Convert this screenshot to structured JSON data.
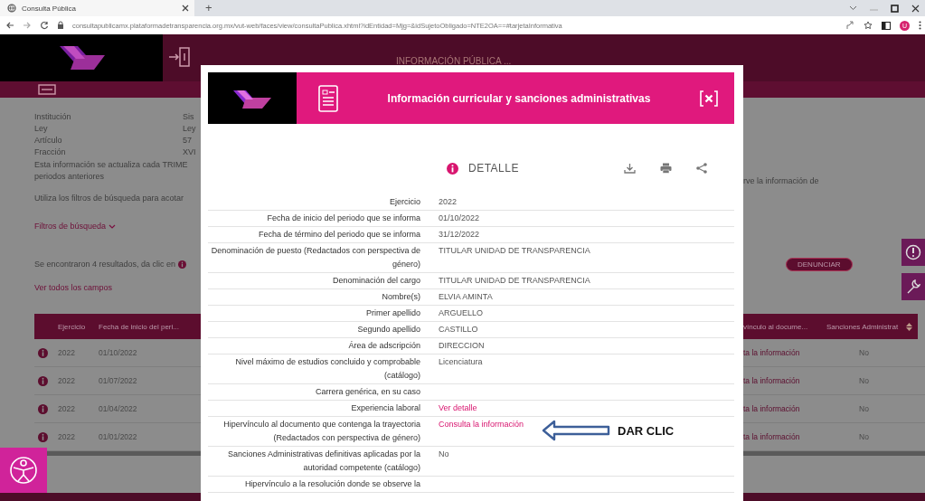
{
  "browser": {
    "tab_title": "Consulta Pública",
    "new_tab": "+",
    "url": "consultapublicamx.plataformadetransparencia.org.mx/vut-web/faces/view/consultaPublica.xhtml?idEntidad=Mjg=&idSujetoObligado=NTE2OA==#tarjetaInformativa",
    "profile_initial": "U"
  },
  "page": {
    "header_title": "INFORMACIÓN PÚBLICA ...",
    "facts": [
      {
        "label": "Institución",
        "value": "Sis"
      },
      {
        "label": "Ley",
        "value": "Ley"
      },
      {
        "label": "Artículo",
        "value": "57"
      },
      {
        "label": "Fracción",
        "value": "XVI"
      }
    ],
    "notice_lines": [
      "Esta información se actualiza cada TRIME",
      "periodos anteriores"
    ],
    "filter_hint": "Utiliza los filtros de búsqueda para acotar",
    "filters_link": "Filtros de búsqueda",
    "results_text": "Se encontraron 4 resultados, da clic en",
    "all_fields_link": "Ver todos los campos",
    "right_notice": "rve la información de",
    "report_button": "DENUNCIAR",
    "table": {
      "columns_left": [
        "Ejercicio",
        "Fecha de inicio del peri..."
      ],
      "columns_right": [
        "vínculo al docume...",
        "Sanciones Administrat"
      ],
      "rows": [
        {
          "ejercicio": "2022",
          "fecha_inicio": "01/10/2022",
          "hipervinculo": "ta la información",
          "sanciones": "No"
        },
        {
          "ejercicio": "2022",
          "fecha_inicio": "01/07/2022",
          "hipervinculo": "ta la información",
          "sanciones": "No"
        },
        {
          "ejercicio": "2022",
          "fecha_inicio": "01/04/2022",
          "hipervinculo": "ta la información",
          "sanciones": "No"
        },
        {
          "ejercicio": "2022",
          "fecha_inicio": "01/01/2022",
          "hipervinculo": "ta la información",
          "sanciones": "No"
        }
      ]
    }
  },
  "modal": {
    "title": "Información curricular y sanciones administrativas",
    "section": "DETALLE",
    "fields": [
      {
        "label": "Ejercicio",
        "value": "2022",
        "kind": "text"
      },
      {
        "label": "Fecha de inicio del periodo que se informa",
        "value": "01/10/2022",
        "kind": "text"
      },
      {
        "label": "Fecha de término del periodo que se informa",
        "value": "31/12/2022",
        "kind": "text"
      },
      {
        "label": "Denominación de puesto (Redactados con perspectiva de género)",
        "value": "TITULAR UNIDAD DE TRANSPARENCIA",
        "kind": "text"
      },
      {
        "label": "Denominación del cargo",
        "value": "TITULAR UNIDAD DE TRANSPARENCIA",
        "kind": "text"
      },
      {
        "label": "Nombre(s)",
        "value": "ELVIA AMINTA",
        "kind": "text"
      },
      {
        "label": "Primer apellido",
        "value": "ARGUELLO",
        "kind": "text"
      },
      {
        "label": "Segundo apellido",
        "value": "CASTILLO",
        "kind": "text"
      },
      {
        "label": "Área de adscripción",
        "value": "DIRECCION",
        "kind": "text"
      },
      {
        "label": "Nivel máximo de estudios concluido y comprobable (catálogo)",
        "value": "Licenciatura",
        "kind": "text"
      },
      {
        "label": "Carrera genérica, en su caso"
      },
      {
        "label": "Experiencia laboral",
        "value": "Ver detalle",
        "kind": "link"
      },
      {
        "label": "Hipervínculo al documento que contenga la trayectoria (Redactados con perspectiva de género)",
        "value": "Consulta la información",
        "kind": "link",
        "annotation": "DAR CLIC"
      },
      {
        "label": "Sanciones Administrativas definitivas aplicadas por la autoridad competente (catálogo)",
        "value": "No",
        "kind": "text"
      },
      {
        "label": "Hipervínculo a la resolución donde se observe la"
      }
    ]
  }
}
